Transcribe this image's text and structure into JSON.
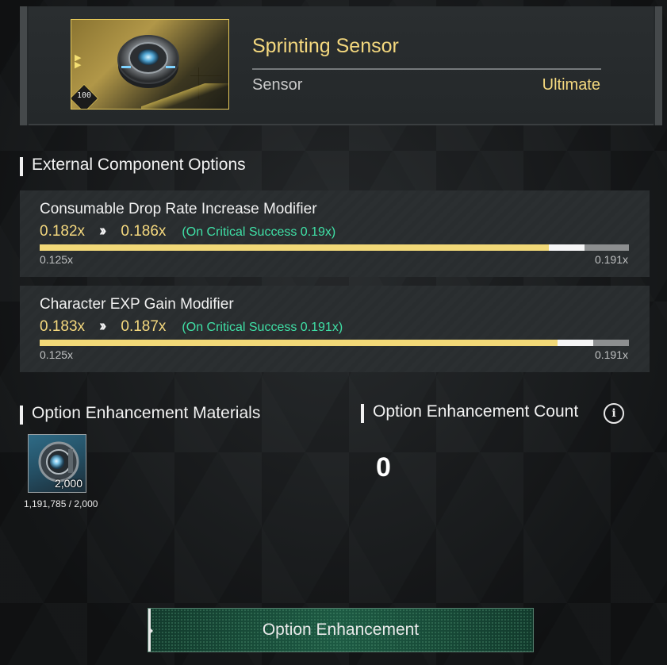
{
  "item": {
    "name": "Sprinting Sensor",
    "type": "Sensor",
    "rarity": "Ultimate",
    "level": "100",
    "icon": "sensor-module-icon"
  },
  "sections": {
    "external_options_title": "External Component Options",
    "materials_title": "Option Enhancement Materials",
    "count_title": "Option Enhancement Count"
  },
  "options": [
    {
      "name": "Consumable Drop Rate Increase Modifier",
      "current": "0.182x",
      "next": "0.186x",
      "critical": "(On Critical Success 0.19x)",
      "min": "0.125x",
      "max": "0.191x",
      "current_fraction": 0.864,
      "next_fraction": 0.924
    },
    {
      "name": "Character EXP Gain Modifier",
      "current": "0.183x",
      "next": "0.187x",
      "critical": "(On Critical Success 0.191x)",
      "min": "0.125x",
      "max": "0.191x",
      "current_fraction": 0.879,
      "next_fraction": 0.939
    }
  ],
  "material": {
    "icon": "enhancement-core-icon",
    "quantity": "2,000",
    "owned_vs_required": "1,191,785 / 2,000"
  },
  "enhancement_count": "0",
  "button": {
    "label": "Option Enhancement"
  },
  "colors": {
    "gold": "#f4d87e",
    "critical_green": "#3fe0a6",
    "button_green": "#1d5a43"
  }
}
